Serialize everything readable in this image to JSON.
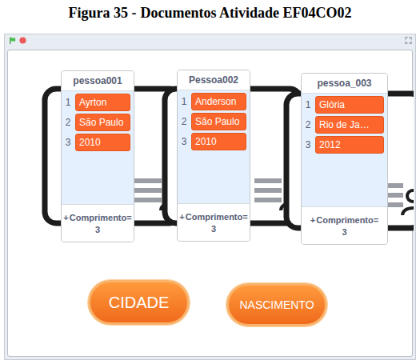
{
  "caption": {
    "label": "Figura 35 -",
    "title": "Documentos Atividade EF04CO02"
  },
  "lists": [
    {
      "name": "pessoa001",
      "items": [
        {
          "index": "1",
          "value": "Ayrton"
        },
        {
          "index": "2",
          "value": "São Paulo"
        },
        {
          "index": "3",
          "value": "2010"
        }
      ],
      "add": "+",
      "lengthLabel": "Comprimento=",
      "length": "3"
    },
    {
      "name": "Pessoa002",
      "items": [
        {
          "index": "1",
          "value": "Anderson"
        },
        {
          "index": "2",
          "value": "São Paulo"
        },
        {
          "index": "3",
          "value": "2010"
        }
      ],
      "add": "+",
      "lengthLabel": "Comprimento=",
      "length": "3"
    },
    {
      "name": "pessoa_003",
      "items": [
        {
          "index": "1",
          "value": "Glória"
        },
        {
          "index": "2",
          "value": "Rio de Ja…"
        },
        {
          "index": "3",
          "value": "2012"
        }
      ],
      "add": "+",
      "lengthLabel": "Comprimento=",
      "length": "3"
    }
  ],
  "buttons": [
    {
      "label": "CIDADE"
    },
    {
      "label": "NASCIMENTO"
    }
  ]
}
